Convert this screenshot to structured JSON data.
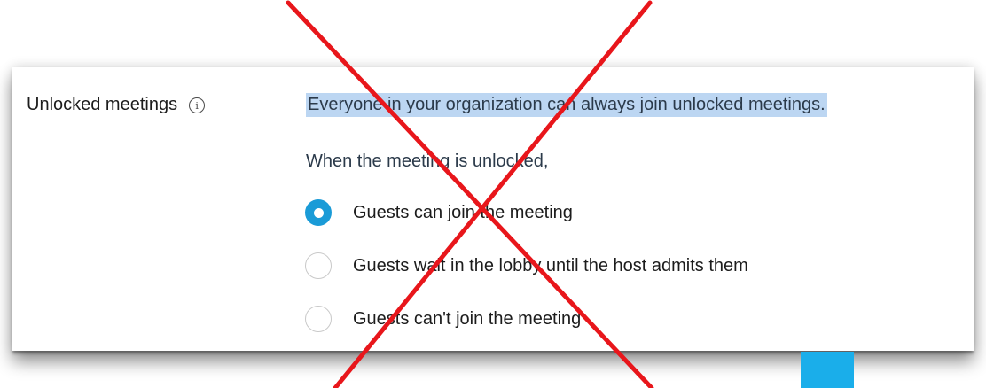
{
  "setting": {
    "label": "Unlocked meetings",
    "info_glyph": "i",
    "info_icon": "info-circle-icon"
  },
  "description": "Everyone in your organization can always join unlocked meetings.",
  "sub_heading": "When the meeting is unlocked,",
  "options": [
    {
      "label": "Guests can join the meeting",
      "selected": true
    },
    {
      "label": "Guests wait in the lobby until the host admits them",
      "selected": false
    },
    {
      "label": "Guests can't join the meeting",
      "selected": false
    }
  ],
  "colors": {
    "accent": "#1a9bd7",
    "highlight": "#bcd6f2",
    "cross": "#e8161b",
    "corner_square": "#1aaeea"
  }
}
